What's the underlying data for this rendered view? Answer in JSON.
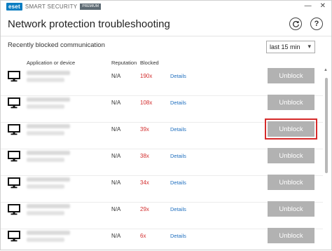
{
  "app": {
    "logo_text": "eset",
    "product_name": "SMART SECURITY",
    "edition": "PREMIUM"
  },
  "window_controls": {
    "minimize": "—",
    "close": "✕"
  },
  "header": {
    "title": "Network protection troubleshooting",
    "refresh_icon": "refresh-icon",
    "help_icon": "help-icon",
    "help_glyph": "?"
  },
  "subheader": {
    "label": "Recently blocked communication",
    "time_filter": "last 15 min"
  },
  "table": {
    "columns": {
      "app": "Application or device",
      "reputation": "Reputation",
      "blocked": "Blocked"
    },
    "rows": [
      {
        "reputation": "N/A",
        "blocked": "190x",
        "details": "Details",
        "action": "Unblock",
        "highlighted": false
      },
      {
        "reputation": "N/A",
        "blocked": "108x",
        "details": "Details",
        "action": "Unblock",
        "highlighted": false
      },
      {
        "reputation": "N/A",
        "blocked": "39x",
        "details": "Details",
        "action": "Unblock",
        "highlighted": true
      },
      {
        "reputation": "N/A",
        "blocked": "38x",
        "details": "Details",
        "action": "Unblock",
        "highlighted": false
      },
      {
        "reputation": "N/A",
        "blocked": "34x",
        "details": "Details",
        "action": "Unblock",
        "highlighted": false
      },
      {
        "reputation": "N/A",
        "blocked": "29x",
        "details": "Details",
        "action": "Unblock",
        "highlighted": false
      },
      {
        "reputation": "N/A",
        "blocked": "6x",
        "details": "Details",
        "action": "Unblock",
        "highlighted": false
      }
    ]
  },
  "colors": {
    "accent": "#0a7dc2",
    "blocked_count": "#d32f2f",
    "link": "#1f6fbf",
    "button_bg": "#b2b2b2",
    "highlight": "#d62a2a"
  }
}
